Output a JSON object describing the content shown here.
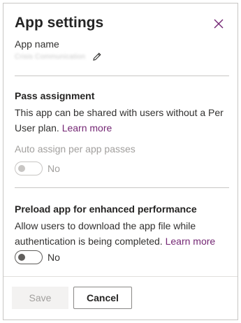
{
  "panel": {
    "title": "App settings",
    "close_icon": "close-icon"
  },
  "app_name": {
    "label": "App name",
    "value": "Crisis Communication",
    "edit_icon": "pencil-icon"
  },
  "pass_assignment": {
    "title": "Pass assignment",
    "description": "This app can be shared with users without a Per User plan.",
    "link": "Learn more",
    "auto_assign_label": "Auto assign per app passes",
    "toggle_state": "No",
    "toggle_enabled": false
  },
  "preload": {
    "title": "Preload app for enhanced performance",
    "description": "Allow users to download the app file while authentication is being completed.",
    "link": "Learn more",
    "toggle_state": "No",
    "toggle_enabled": true
  },
  "footer": {
    "save_label": "Save",
    "cancel_label": "Cancel"
  },
  "colors": {
    "accent_link": "#742774",
    "border": "#c8c6c4",
    "disabled_text": "#a19f9d"
  }
}
